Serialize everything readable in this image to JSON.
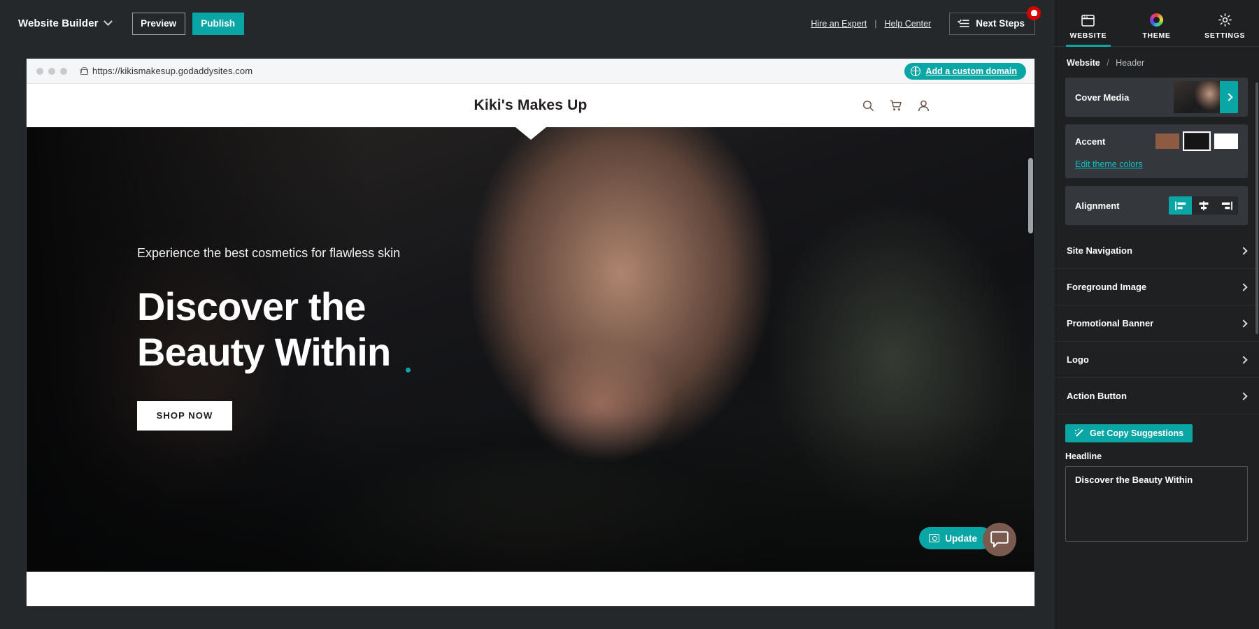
{
  "toolbar": {
    "brand": "Website Builder",
    "preview_label": "Preview",
    "publish_label": "Publish",
    "hire_expert_label": "Hire an Expert",
    "separator": "|",
    "help_center_label": "Help Center",
    "next_steps_label": "Next Steps",
    "accent_color": "#0aa5a5",
    "badge_color": "#d60000"
  },
  "browser": {
    "url": "https://kikismakesup.godaddysites.com",
    "custom_domain_label": "Add a custom domain"
  },
  "site": {
    "title": "Kiki's Makes Up",
    "icons": [
      "search-icon",
      "cart-icon",
      "account-icon"
    ],
    "icon_color": "#6b5347",
    "hero": {
      "subheading": "Experience the best cosmetics for flawless skin",
      "headline": "Discover the Beauty Within",
      "cta_label": "SHOP NOW"
    },
    "update_label": "Update"
  },
  "panel": {
    "tabs": [
      {
        "label": "WEBSITE",
        "icon": "browser-window-icon",
        "active": true
      },
      {
        "label": "THEME",
        "icon": "color-wheel-icon",
        "active": false
      },
      {
        "label": "SETTINGS",
        "icon": "gear-icon",
        "active": false
      }
    ],
    "breadcrumb": {
      "root": "Website",
      "separator": "/",
      "leaf": "Header"
    },
    "cover_media": {
      "label": "Cover Media"
    },
    "accent": {
      "label": "Accent",
      "edit_link": "Edit theme colors",
      "swatches": [
        {
          "name": "brown",
          "color": "#8d5a42",
          "selected": false
        },
        {
          "name": "black",
          "color": "#151515",
          "selected": true
        },
        {
          "name": "white",
          "color": "#ffffff",
          "selected": false
        }
      ]
    },
    "alignment": {
      "label": "Alignment",
      "options": [
        {
          "name": "align-left",
          "active": true
        },
        {
          "name": "align-center",
          "active": false
        },
        {
          "name": "align-right",
          "active": false
        }
      ]
    },
    "sections": [
      {
        "label": "Site Navigation"
      },
      {
        "label": "Foreground Image"
      },
      {
        "label": "Promotional Banner"
      },
      {
        "label": "Logo"
      },
      {
        "label": "Action Button"
      }
    ],
    "copy_suggestions_label": "Get Copy Suggestions",
    "headline_label": "Headline",
    "headline_value": "Discover the Beauty Within"
  }
}
